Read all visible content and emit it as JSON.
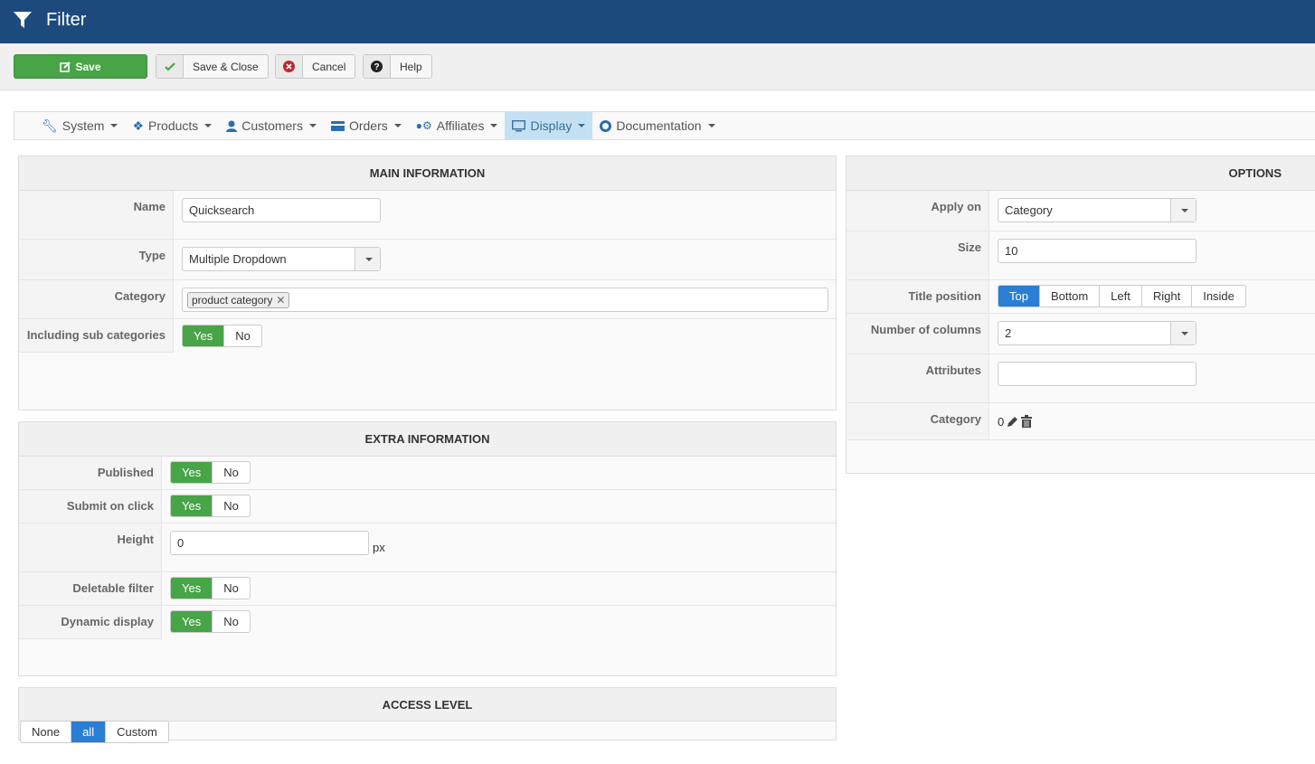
{
  "header": {
    "title": "Filter",
    "icon": "filter-icon"
  },
  "toolbar": {
    "save": "Save",
    "save_close": "Save & Close",
    "cancel": "Cancel",
    "help": "Help"
  },
  "nav": [
    {
      "label": "System"
    },
    {
      "label": "Products"
    },
    {
      "label": "Customers"
    },
    {
      "label": "Orders"
    },
    {
      "label": "Affiliates"
    },
    {
      "label": "Display",
      "active": true
    },
    {
      "label": "Documentation"
    }
  ],
  "main_info": {
    "title": "MAIN INFORMATION",
    "name_label": "Name",
    "name_value": "Quicksearch",
    "type_label": "Type",
    "type_value": "Multiple Dropdown",
    "category_label": "Category",
    "category_chip": "product category",
    "subcat_label": "Including sub categories"
  },
  "extra_info": {
    "title": "EXTRA INFORMATION",
    "published_label": "Published",
    "submit_label": "Submit on click",
    "height_label": "Height",
    "height_value": "0",
    "height_unit": "px",
    "deletable_label": "Deletable filter",
    "dynamic_label": "Dynamic display"
  },
  "toggle": {
    "yes": "Yes",
    "no": "No"
  },
  "access": {
    "title": "ACCESS LEVEL",
    "options": [
      "None",
      "all",
      "Custom"
    ],
    "selected": "all"
  },
  "options": {
    "title": "OPTIONS",
    "apply_label": "Apply on",
    "apply_value": "Category",
    "size_label": "Size",
    "size_value": "10",
    "titlepos_label": "Title position",
    "titlepos_options": [
      "Top",
      "Bottom",
      "Left",
      "Right",
      "Inside"
    ],
    "titlepos_selected": "Top",
    "columns_label": "Number of columns",
    "columns_value": "2",
    "attributes_label": "Attributes",
    "attributes_value": "",
    "category_label": "Category",
    "category_value": "0"
  },
  "colors": {
    "header": "#1c4a7c",
    "green": "#47a447",
    "blue": "#2a7fd4"
  }
}
